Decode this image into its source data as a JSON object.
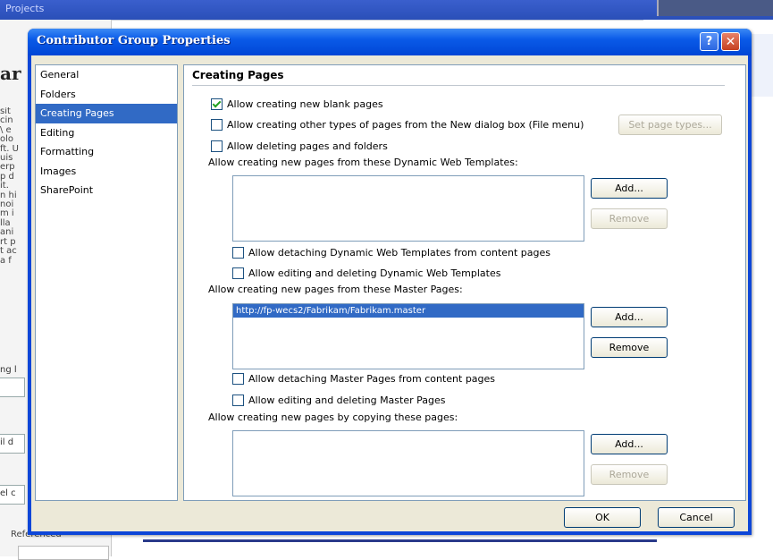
{
  "background": {
    "title": "Projects",
    "heading": "ar",
    "text_lines": [
      "sit",
      "cin",
      "\\ e",
      "olo",
      "ft. U",
      "uis",
      "erp",
      "p d",
      "it. ",
      "n hi",
      "noi",
      "m i",
      "lla",
      "ani",
      "rt p",
      "t ac",
      "a f"
    ],
    "frag_1": "ng l",
    "frag_2": "il d",
    "frag_3": "el c",
    "bottom_text": "Referenced"
  },
  "dialog": {
    "title": "Contributor Group Properties",
    "help_label": "?",
    "close_label": "✕"
  },
  "nav": {
    "items": [
      {
        "label": "General"
      },
      {
        "label": "Folders"
      },
      {
        "label": "Creating Pages"
      },
      {
        "label": "Editing"
      },
      {
        "label": "Formatting"
      },
      {
        "label": "Images"
      },
      {
        "label": "SharePoint"
      }
    ],
    "selected": "Creating Pages"
  },
  "content": {
    "section_title": "Creating Pages",
    "allow_blank": {
      "label": "Allow creating new blank pages",
      "checked": true
    },
    "allow_other": {
      "label": "Allow creating other types of pages from the New dialog box (File menu)",
      "checked": false
    },
    "set_page_types": "Set page types...",
    "allow_delete": {
      "label": "Allow deleting pages and folders",
      "checked": false
    },
    "dwt_label": "Allow creating new pages from these Dynamic Web Templates:",
    "dwt_add": "Add...",
    "dwt_remove": "Remove",
    "dwt_detach": {
      "label": "Allow detaching Dynamic Web Templates from content pages",
      "checked": false
    },
    "dwt_edit": {
      "label": "Allow editing and deleting Dynamic Web Templates",
      "checked": false
    },
    "master_label": "Allow creating new pages from these Master Pages:",
    "master_items": [
      "http://fp-wecs2/Fabrikam/Fabrikam.master"
    ],
    "master_add": "Add...",
    "master_remove": "Remove",
    "master_detach": {
      "label": "Allow detaching Master Pages from content pages",
      "checked": false
    },
    "master_edit": {
      "label": "Allow editing and deleting Master Pages",
      "checked": false
    },
    "copy_label": "Allow creating new pages by copying these pages:",
    "copy_add": "Add...",
    "copy_remove": "Remove"
  },
  "footer": {
    "ok": "OK",
    "cancel": "Cancel"
  }
}
